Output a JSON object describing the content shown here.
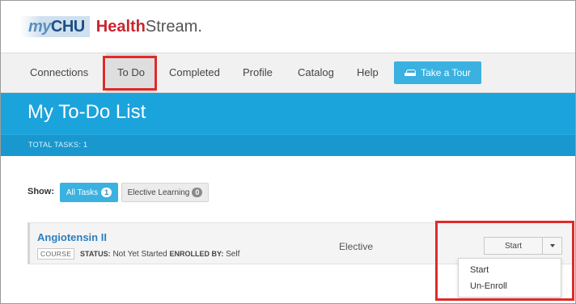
{
  "header": {
    "logo_my": "my",
    "logo_chu": "CHU",
    "logo_health": "Health",
    "logo_stream": "Stream."
  },
  "nav": {
    "items": [
      {
        "label": "Connections"
      },
      {
        "label": "To Do"
      },
      {
        "label": "Completed"
      },
      {
        "label": "Profile"
      },
      {
        "label": "Catalog"
      },
      {
        "label": "Help"
      }
    ],
    "selected": "To Do",
    "tour_label": "Take a Tour",
    "tour_icon": "car-icon"
  },
  "page": {
    "title": "My To-Do List",
    "total_tasks_label": "TOTAL TASKS:",
    "total_tasks_count": "1"
  },
  "filters": {
    "show_label": "Show:",
    "all_tasks_label": "All Tasks",
    "all_tasks_count": "1",
    "elective_label": "Elective Learning",
    "elective_count": "0"
  },
  "task": {
    "title": "Angiotensin II",
    "type_tag": "COURSE",
    "status_label": "STATUS:",
    "status_value": "Not Yet Started",
    "enrolled_label": "ENROLLED BY:",
    "enrolled_value": "Self",
    "category": "Elective",
    "action_label": "Start",
    "menu_items": [
      "Start",
      "Un-Enroll"
    ]
  },
  "colors": {
    "accent_blue": "#1ba3dc",
    "button_blue": "#3ab1e0",
    "brand_red": "#c8262f",
    "highlight_red": "#e02a2a",
    "link_blue": "#2b7fc0"
  }
}
